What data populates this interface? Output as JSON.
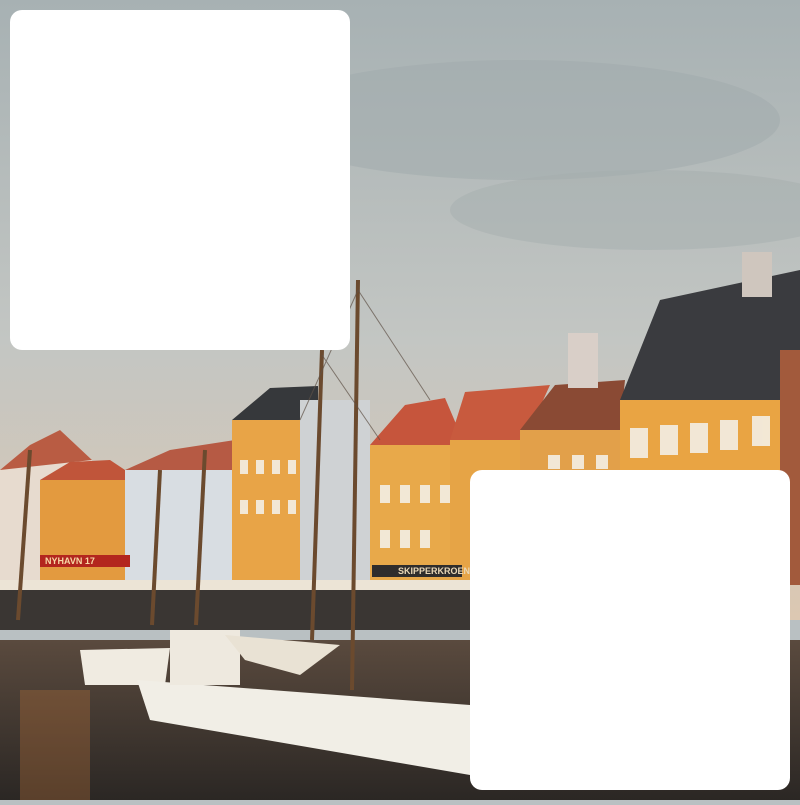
{
  "photo": {
    "colors": {
      "sky_top": "#a9b3b4",
      "sky_bottom": "#d9c9b6",
      "water": "#3a3431",
      "yellow_building": "#e9a94a",
      "red_roof": "#c8573c",
      "dark_roof": "#3c3d40",
      "boat_hull": "#f1eee6"
    },
    "signs": {
      "shop_sign": "SKIPPERKROEN",
      "red_sign": "NYHAVN 17"
    }
  },
  "overlays": {
    "top_card": {},
    "bottom_card": {}
  }
}
